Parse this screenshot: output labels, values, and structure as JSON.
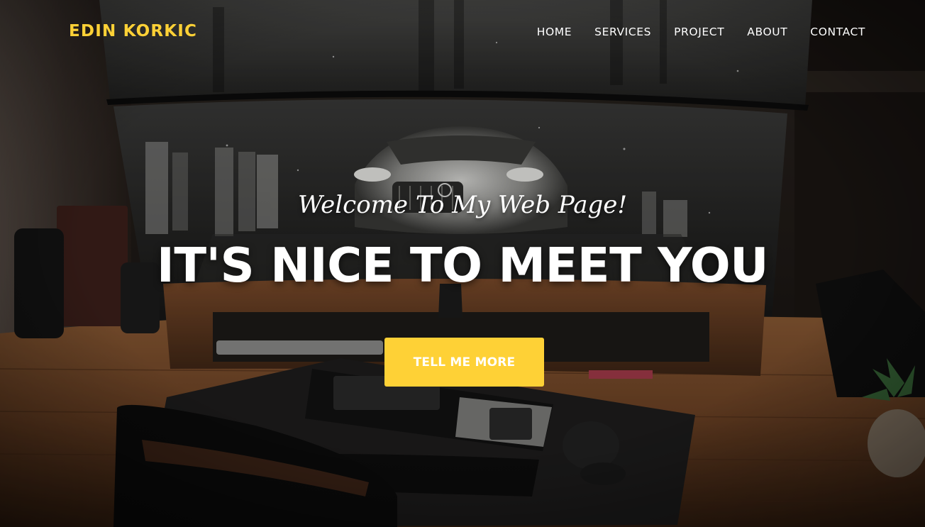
{
  "brand": {
    "name": "EDIN KORKIC",
    "color": "#fed136"
  },
  "nav": {
    "items": [
      {
        "label": "HOME"
      },
      {
        "label": "SERVICES"
      },
      {
        "label": "PROJECT"
      },
      {
        "label": "ABOUT"
      },
      {
        "label": "CONTACT"
      }
    ]
  },
  "hero": {
    "lead_in": "Welcome To My Web Page!",
    "heading": "IT'S NICE TO MEET YOU",
    "button_label": "TELL ME MORE",
    "button_color": "#fed136",
    "background_image": "desk-setup-photo"
  }
}
